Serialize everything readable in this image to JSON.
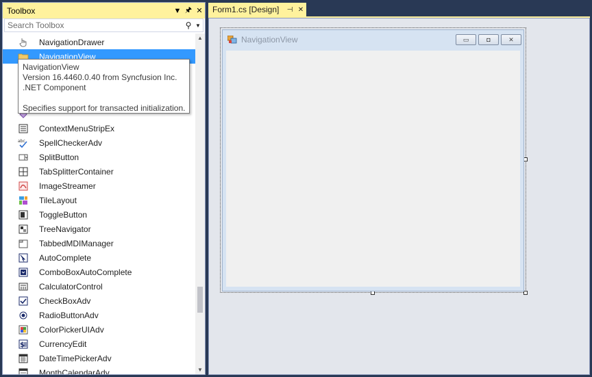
{
  "toolbox": {
    "title": "Toolbox",
    "search_placeholder": "Search Toolbox",
    "items": [
      {
        "label": "NavigationDrawer",
        "icon": "hand-pointer-icon"
      },
      {
        "label": "NavigationView",
        "icon": "folder-icon",
        "selected": true
      },
      {
        "label": "",
        "icon": "form-icon"
      },
      {
        "label": "",
        "icon": "component-icon"
      },
      {
        "label": "",
        "icon": "component-icon"
      },
      {
        "label": "",
        "icon": "diamond-icon"
      },
      {
        "label": "ContextMenuStripEx",
        "icon": "menu-strip-icon"
      },
      {
        "label": "SpellCheckerAdv",
        "icon": "spellcheck-icon"
      },
      {
        "label": "SplitButton",
        "icon": "split-button-icon"
      },
      {
        "label": "TabSplitterContainer",
        "icon": "tab-splitter-icon"
      },
      {
        "label": "ImageStreamer",
        "icon": "image-streamer-icon"
      },
      {
        "label": "TileLayout",
        "icon": "tile-layout-icon"
      },
      {
        "label": "ToggleButton",
        "icon": "toggle-button-icon"
      },
      {
        "label": "TreeNavigator",
        "icon": "tree-navigator-icon"
      },
      {
        "label": "TabbedMDIManager",
        "icon": "tabbed-mdi-icon"
      },
      {
        "label": "AutoComplete",
        "icon": "autocomplete-icon"
      },
      {
        "label": "ComboBoxAutoComplete",
        "icon": "combobox-autocomplete-icon"
      },
      {
        "label": "CalculatorControl",
        "icon": "calculator-icon"
      },
      {
        "label": "CheckBoxAdv",
        "icon": "checkbox-icon"
      },
      {
        "label": "RadioButtonAdv",
        "icon": "radio-button-icon"
      },
      {
        "label": "ColorPickerUIAdv",
        "icon": "color-picker-icon"
      },
      {
        "label": "CurrencyEdit",
        "icon": "currency-icon"
      },
      {
        "label": "DateTimePickerAdv",
        "icon": "datetime-picker-icon"
      },
      {
        "label": "MonthCalendarAdv",
        "icon": "calendar-icon"
      }
    ]
  },
  "tooltip": {
    "line1": "NavigationView",
    "line2": "Version 16.4460.0.40 from Syncfusion Inc.",
    "line3": ".NET Component",
    "line4": "Specifies support for transacted initialization."
  },
  "document_tab": {
    "title": "Form1.cs [Design]"
  },
  "form": {
    "title": "NavigationView"
  },
  "colors": {
    "accent_tab": "#fff29d",
    "selection": "#3399ff",
    "ide_background": "#293955"
  }
}
